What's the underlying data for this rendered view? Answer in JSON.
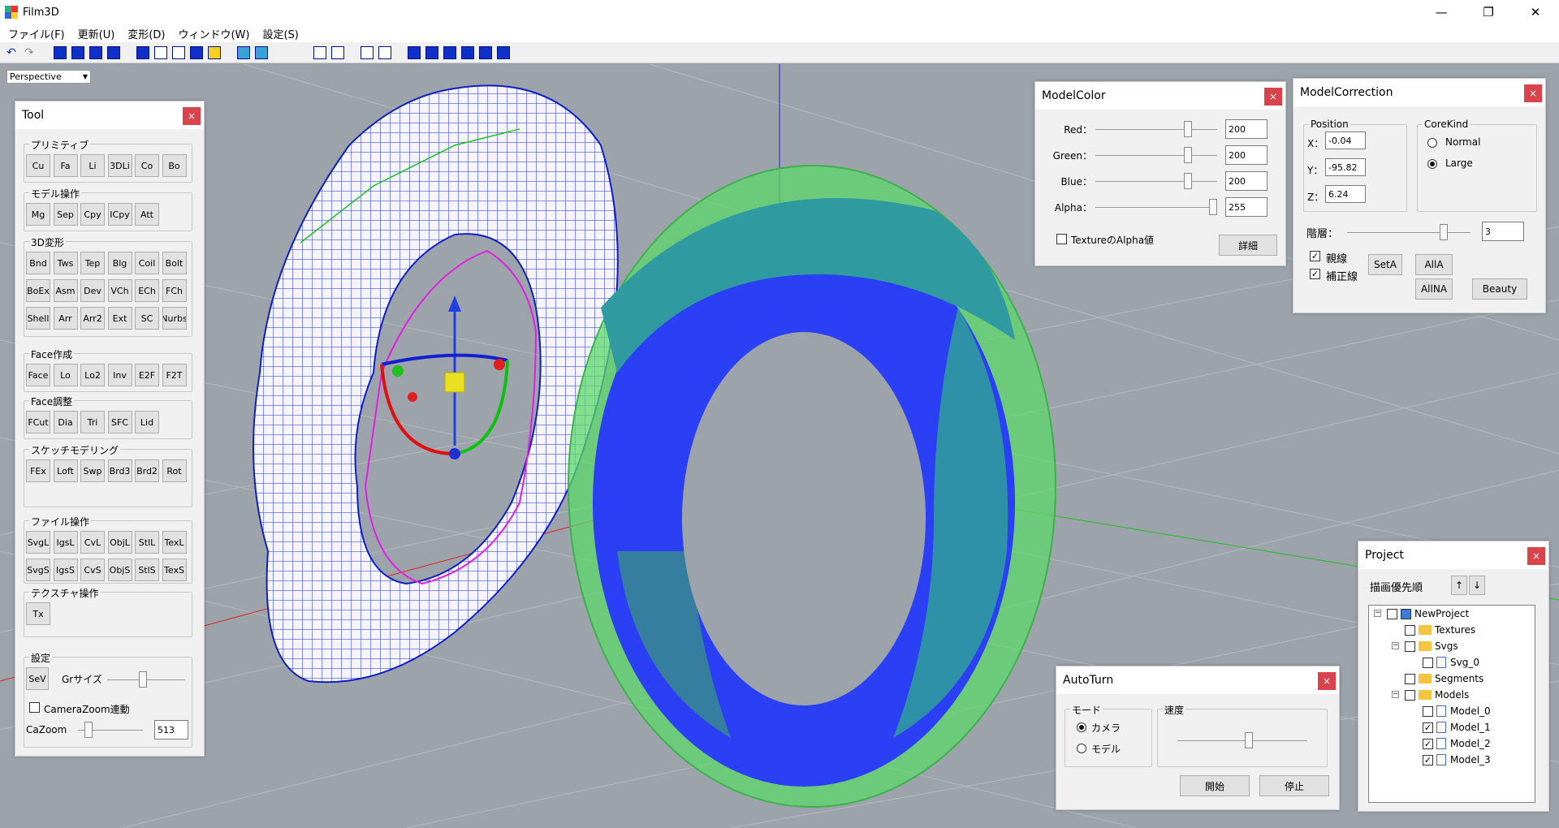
{
  "window": {
    "title": "Film3D",
    "min": "—",
    "max": "❐",
    "close": "✕"
  },
  "menu": [
    "ファイル(F)",
    "更新(U)",
    "変形(D)",
    "ウィンドウ(W)",
    "設定(S)"
  ],
  "view": {
    "mode": "Perspective"
  },
  "tool": {
    "title": "Tool",
    "close": "×",
    "groups": [
      {
        "label": "プリミティブ",
        "rows": [
          [
            "Cu",
            "Fa",
            "Li",
            "3DLi",
            "Co",
            "Bo"
          ]
        ]
      },
      {
        "label": "モデル操作",
        "rows": [
          [
            "Mg",
            "Sep",
            "Cpy",
            "ICpy",
            "Att"
          ]
        ]
      },
      {
        "label": "3D変形",
        "rows": [
          [
            "Bnd",
            "Tws",
            "Tep",
            "Blg",
            "Coil",
            "Bolt"
          ],
          [
            "BoEx",
            "Asm",
            "Dev",
            "VCh",
            "ECh",
            "FCh"
          ],
          [
            "Shell",
            "Arr",
            "Arr2",
            "Ext",
            "SC",
            "Nurbs"
          ]
        ]
      },
      {
        "label": "Face作成",
        "rows": [
          [
            "Face",
            "Lo",
            "Lo2",
            "Inv",
            "E2F",
            "F2T"
          ]
        ]
      },
      {
        "label": "Face調整",
        "rows": [
          [
            "FCut",
            "Dia",
            "Tri",
            "SFC",
            "Lid"
          ]
        ]
      },
      {
        "label": "スケッチモデリング",
        "rows": [
          [
            "FEx",
            "Loft",
            "Swp",
            "Brd3",
            "Brd2",
            "Rot"
          ]
        ]
      },
      {
        "label": "ファイル操作",
        "rows": [
          [
            "SvgL",
            "IgsL",
            "CvL",
            "ObjL",
            "StlL",
            "TexL"
          ],
          [
            "SvgS",
            "IgsS",
            "CvS",
            "ObjS",
            "StlS",
            "TexS"
          ]
        ]
      },
      {
        "label": "テクスチャ操作",
        "rows": [
          [
            "Tx"
          ]
        ]
      }
    ],
    "settings": {
      "label": "設定",
      "sev": "SeV",
      "gr_label": "Grサイズ",
      "camzoom": "CameraZoom連動",
      "cazoom_label": "CaZoom",
      "cazoom_value": "513",
      "gr_level": 0.45,
      "cazoom_level": 0.12
    }
  },
  "model_color": {
    "title": "ModelColor",
    "close": "×",
    "rows": [
      {
        "label": "Red：",
        "value": "200",
        "level": 0.78
      },
      {
        "label": "Green：",
        "value": "200",
        "level": 0.78
      },
      {
        "label": "Blue：",
        "value": "200",
        "level": 0.78
      },
      {
        "label": "Alpha：",
        "value": "255",
        "level": 1.0
      }
    ],
    "texture_alpha": "TextureのAlpha値",
    "detail": "詳細"
  },
  "model_correction": {
    "title": "ModelCorrection",
    "close": "×",
    "position_label": "Position",
    "x_label": "X：",
    "y_label": "Y：",
    "z_label": "Z：",
    "x": "-0.04",
    "y": "-95.82",
    "z": "6.24",
    "corekind_label": "CoreKind",
    "normal": "Normal",
    "large": "Large",
    "layer_label": "階層：",
    "layer_value": "3",
    "layer_level": 0.8,
    "parent_line": "親線",
    "aux_line": "補正線",
    "seta": "SetA",
    "alla": "AllA",
    "allna": "AllNA",
    "beauty": "Beauty"
  },
  "project": {
    "title": "Project",
    "close": "×",
    "priority_label": "描画優先順",
    "up": "↑",
    "down": "↓",
    "tree": [
      {
        "label": "NewProject",
        "depth": 0,
        "checked": false,
        "icon": "project",
        "exp": "−"
      },
      {
        "label": "Textures",
        "depth": 1,
        "checked": false,
        "icon": "folder",
        "exp": ""
      },
      {
        "label": "Svgs",
        "depth": 1,
        "checked": false,
        "icon": "folder",
        "exp": "−"
      },
      {
        "label": "Svg_0",
        "depth": 2,
        "checked": false,
        "icon": "doc",
        "exp": ""
      },
      {
        "label": "Segments",
        "depth": 1,
        "checked": false,
        "icon": "folder",
        "exp": ""
      },
      {
        "label": "Models",
        "depth": 1,
        "checked": false,
        "icon": "folder",
        "exp": "−"
      },
      {
        "label": "Model_0",
        "depth": 2,
        "checked": false,
        "icon": "doc",
        "exp": ""
      },
      {
        "label": "Model_1",
        "depth": 2,
        "checked": true,
        "icon": "doc",
        "exp": ""
      },
      {
        "label": "Model_2",
        "depth": 2,
        "checked": true,
        "icon": "doc",
        "exp": ""
      },
      {
        "label": "Model_3",
        "depth": 2,
        "checked": true,
        "icon": "doc",
        "exp": ""
      }
    ]
  },
  "autoturn": {
    "title": "AutoTurn",
    "close": "×",
    "mode_label": "モード",
    "camera": "カメラ",
    "model": "モデル",
    "speed_label": "速度",
    "speed_level": 0.55,
    "start": "開始",
    "stop": "停止"
  },
  "colors": {
    "close": "#d9434c",
    "accent_blue": "#1030c8"
  }
}
